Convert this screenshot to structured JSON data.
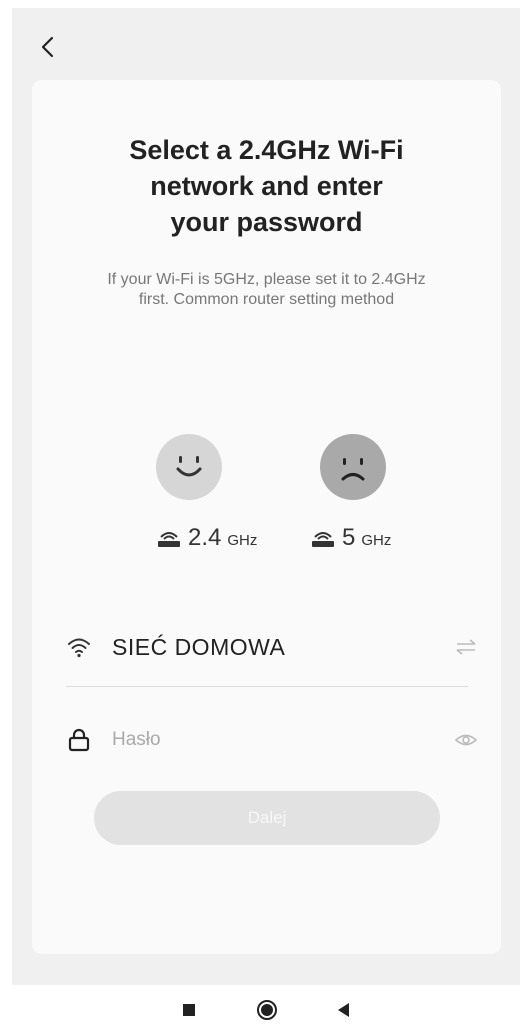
{
  "header": {
    "back_icon": "chevron-left-icon"
  },
  "card": {
    "title": "Select a 2.4GHz Wi-Fi\nnetwork and enter\nyour password",
    "subtitle": "If your Wi-Fi is 5GHz, please set it to 2.4GHz first. Common router setting method"
  },
  "bands": {
    "good": {
      "icon": "smile-face-icon",
      "router_icon": "router-icon",
      "value": "2.4",
      "unit": "GHz"
    },
    "bad": {
      "icon": "sad-face-icon",
      "router_icon": "router-icon",
      "value": "5",
      "unit": "GHz"
    }
  },
  "ssid": {
    "icon": "wifi-icon",
    "value": "SIEĆ DOMOWA",
    "switch_icon": "switch-arrows-icon"
  },
  "password": {
    "icon": "lock-icon",
    "placeholder": "Hasło",
    "value": "",
    "eye_icon": "eye-icon"
  },
  "next_button": {
    "label": "Dalej"
  },
  "navbar": {
    "recents_icon": "square-icon",
    "home_icon": "circle-icon",
    "back_icon": "triangle-back-icon"
  },
  "colors": {
    "button_disabled": "#e2e2e2",
    "card_bg": "#fafafa",
    "screen_bg": "#f0f0f0"
  }
}
